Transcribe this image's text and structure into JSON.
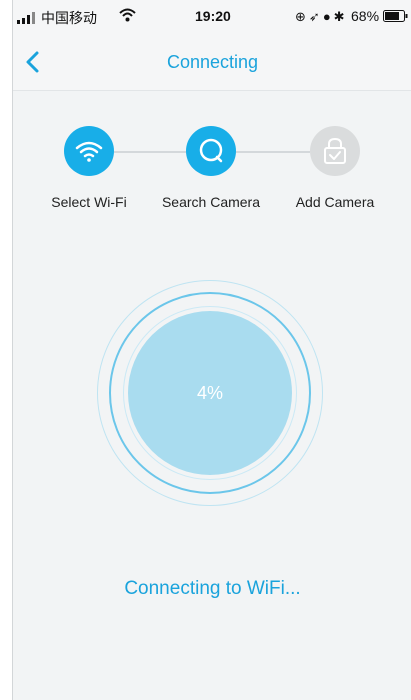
{
  "status_bar": {
    "carrier": "中国移动",
    "time": "19:20",
    "battery_percent": "68%",
    "icons": [
      "signal-icon",
      "wifi-icon",
      "orientation-lock-icon",
      "location-icon",
      "alarm-icon",
      "bluetooth-icon",
      "battery-icon"
    ]
  },
  "nav": {
    "title": "Connecting",
    "back_icon": "chevron-left-icon"
  },
  "steps": [
    {
      "label": "Select Wi-Fi",
      "icon": "wifi-icon",
      "state": "active"
    },
    {
      "label": "Search Camera",
      "icon": "search-icon",
      "state": "active"
    },
    {
      "label": "Add Camera",
      "icon": "lock-check-icon",
      "state": "inactive"
    }
  ],
  "progress": {
    "value": "4%"
  },
  "status_message": "Connecting to WiFi...",
  "colors": {
    "accent": "#1aa3dc",
    "step_active": "#18aee8",
    "step_inactive": "#dadcdd",
    "progress_fill": "#a9dcef"
  }
}
